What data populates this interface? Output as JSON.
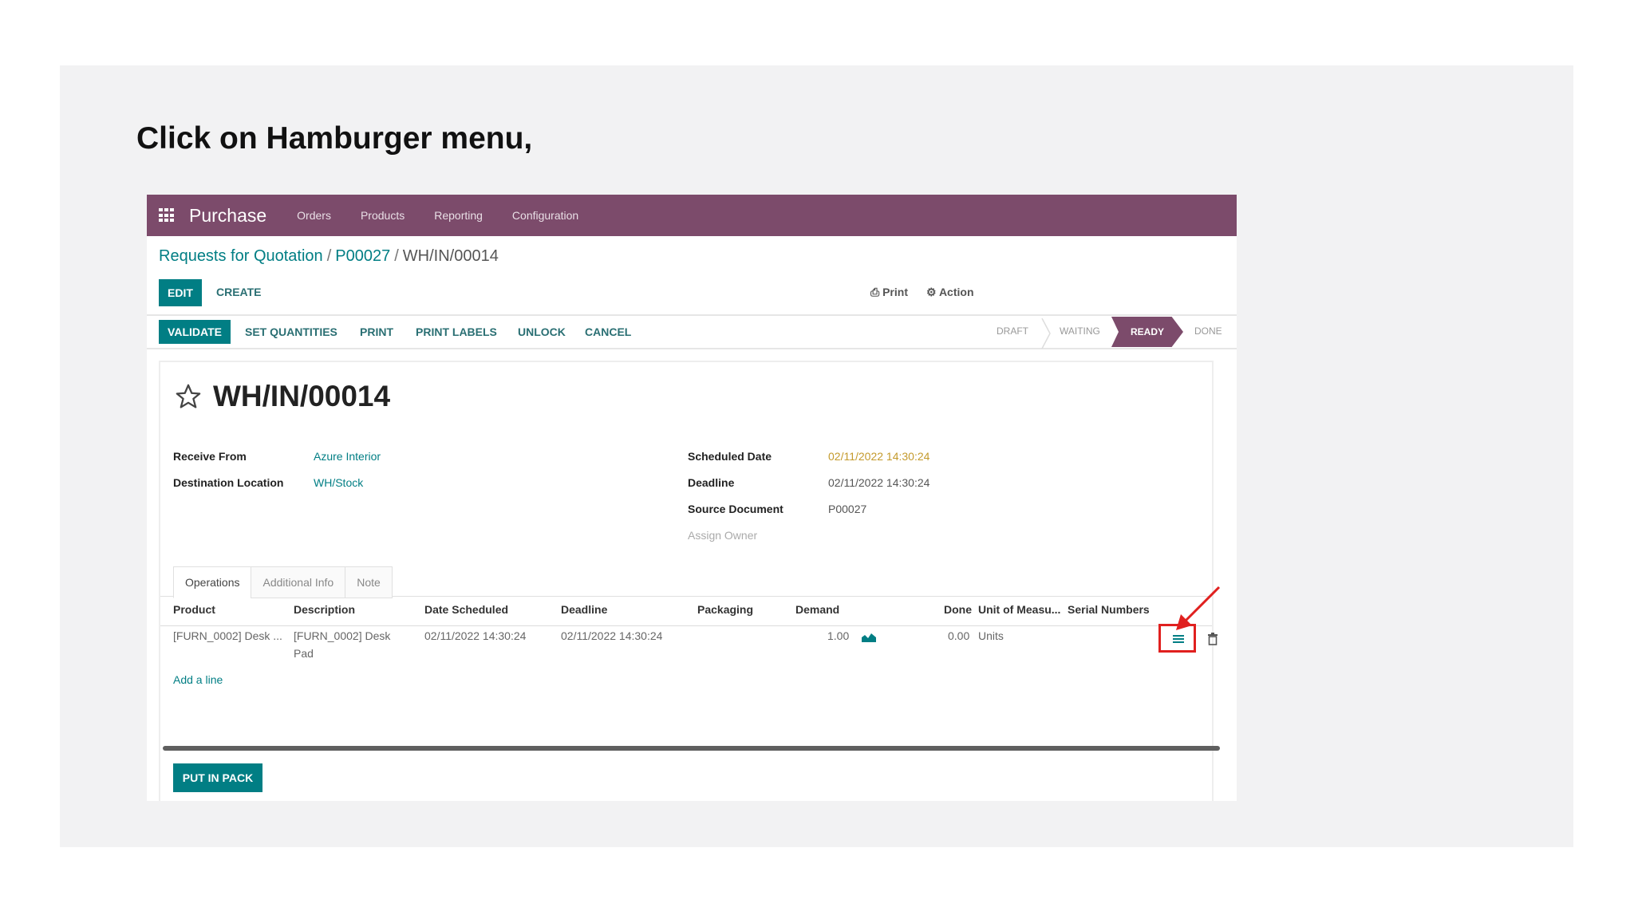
{
  "instruction": "Click on Hamburger menu,",
  "navbar": {
    "app_name": "Purchase",
    "menu": [
      "Orders",
      "Products",
      "Reporting",
      "Configuration"
    ],
    "color": "#7c4b6b"
  },
  "breadcrumb": {
    "items": [
      "Requests for Quotation",
      "P00027",
      "WH/IN/00014"
    ],
    "separator": "/"
  },
  "control_panel": {
    "edit_label": "EDIT",
    "create_label": "CREATE",
    "print_label": "Print",
    "action_label": "Action"
  },
  "action_bar": {
    "buttons": [
      "VALIDATE",
      "SET QUANTITIES",
      "PRINT",
      "PRINT LABELS",
      "UNLOCK",
      "CANCEL"
    ],
    "status_steps": [
      "DRAFT",
      "WAITING",
      "READY",
      "DONE"
    ],
    "current_status": "READY"
  },
  "form": {
    "title": "WH/IN/00014",
    "left_fields": [
      {
        "label": "Receive From",
        "value": "Azure Interior"
      },
      {
        "label": "Destination Location",
        "value": "WH/Stock"
      }
    ],
    "right_fields": [
      {
        "label": "Scheduled Date",
        "value": "02/11/2022 14:30:24"
      },
      {
        "label": "Deadline",
        "value": "02/11/2022 14:30:24"
      },
      {
        "label": "Source Document",
        "value": "P00027"
      },
      {
        "label": "Assign Owner",
        "value": ""
      }
    ],
    "tabs": [
      "Operations",
      "Additional Info",
      "Note"
    ],
    "active_tab": "Operations"
  },
  "operations_table": {
    "columns": [
      "Product",
      "Description",
      "Date Scheduled",
      "Deadline",
      "Packaging",
      "Demand",
      "Done",
      "Unit of Measu...",
      "Serial Numbers"
    ],
    "rows": [
      {
        "product": "[FURN_0002] Desk ...",
        "description_1": "[FURN_0002] Desk",
        "description_2": "Pad",
        "date_scheduled": "02/11/2022 14:30:24",
        "deadline": "02/11/2022 14:30:24",
        "packaging": "",
        "demand": "1.00",
        "done": "0.00",
        "uom": "Units"
      }
    ],
    "add_line_label": "Add a line",
    "details_icon": "list-icon",
    "delete_icon": "trash-icon"
  },
  "footer": {
    "put_in_pack_label": "PUT IN PACK"
  },
  "colors": {
    "accent": "#017e84",
    "highlight": "#e0201f"
  }
}
